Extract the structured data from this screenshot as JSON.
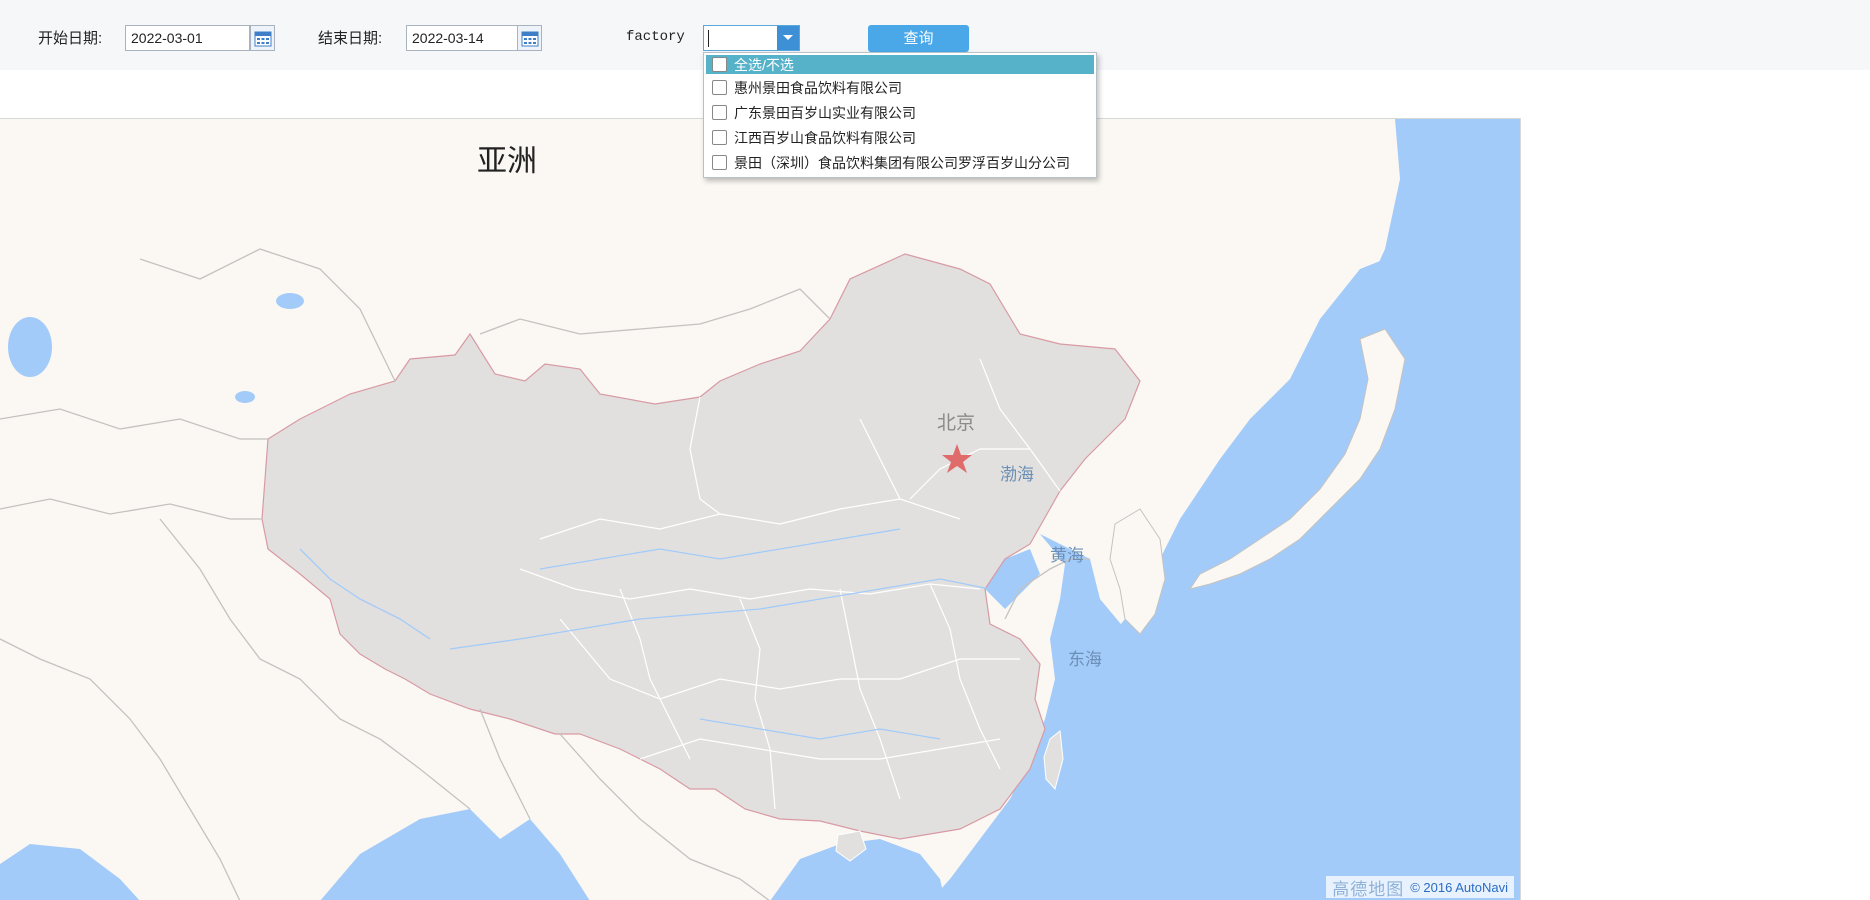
{
  "toolbar": {
    "start_label": "开始日期:",
    "start_value": "2022-03-01",
    "end_label": "结束日期:",
    "end_value": "2022-03-14",
    "factory_label": "factory",
    "factory_value": "",
    "query_label": "查询"
  },
  "dropdown": {
    "select_all_label": "全选/不选",
    "options": [
      {
        "label": "惠州景田食品饮料有限公司",
        "checked": false
      },
      {
        "label": "广东景田百岁山实业有限公司",
        "checked": false
      },
      {
        "label": "江西百岁山食品饮料有限公司",
        "checked": false
      },
      {
        "label": "景田（深圳）食品饮料集团有限公司罗浮百岁山分公司",
        "checked": false
      }
    ]
  },
  "map": {
    "continent_label": "亚洲",
    "capital_label": "北京",
    "seas": {
      "bohai": "渤海",
      "huanghai": "黄海",
      "donghai": "东海"
    },
    "provider_logo": "高德地图",
    "copyright": "© 2016 AutoNavi",
    "colors": {
      "water": "#a3cbf9",
      "land": "#fbf8f3",
      "china": "#e2e0de",
      "border": "#cccccc",
      "marker": "#e06b6b",
      "highlight_row": "#56b2c9",
      "query_button": "#4aa8e8"
    }
  }
}
